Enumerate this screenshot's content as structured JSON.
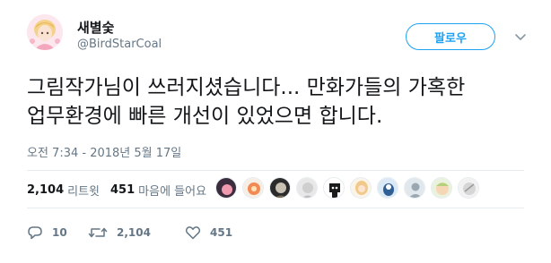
{
  "tweet": {
    "display_name": "새별숯",
    "handle": "@BirdStarCoal",
    "follow_label": "팔로우",
    "text_lines": [
      "그림작가님이 쓰러지셨습니다... 만화가들의 가혹한",
      "업무환경에 빠른 개선이 있었으면 합니다."
    ],
    "timestamp": "오전 7:34 - 2018년 5월 17일",
    "stats": {
      "retweets": "2,104",
      "retweets_label": "리트윗",
      "likes": "451",
      "likes_label": "마음에 들어요"
    },
    "actions": {
      "reply_count": "10",
      "retweet_count": "2,104",
      "like_count": "451"
    }
  },
  "colors": {
    "accent": "#1da1f2",
    "muted": "#657786",
    "text": "#14171a"
  },
  "icons": {
    "more": "chevron-down-icon",
    "reply": "reply-icon",
    "retweet": "retweet-icon",
    "like": "heart-icon"
  }
}
